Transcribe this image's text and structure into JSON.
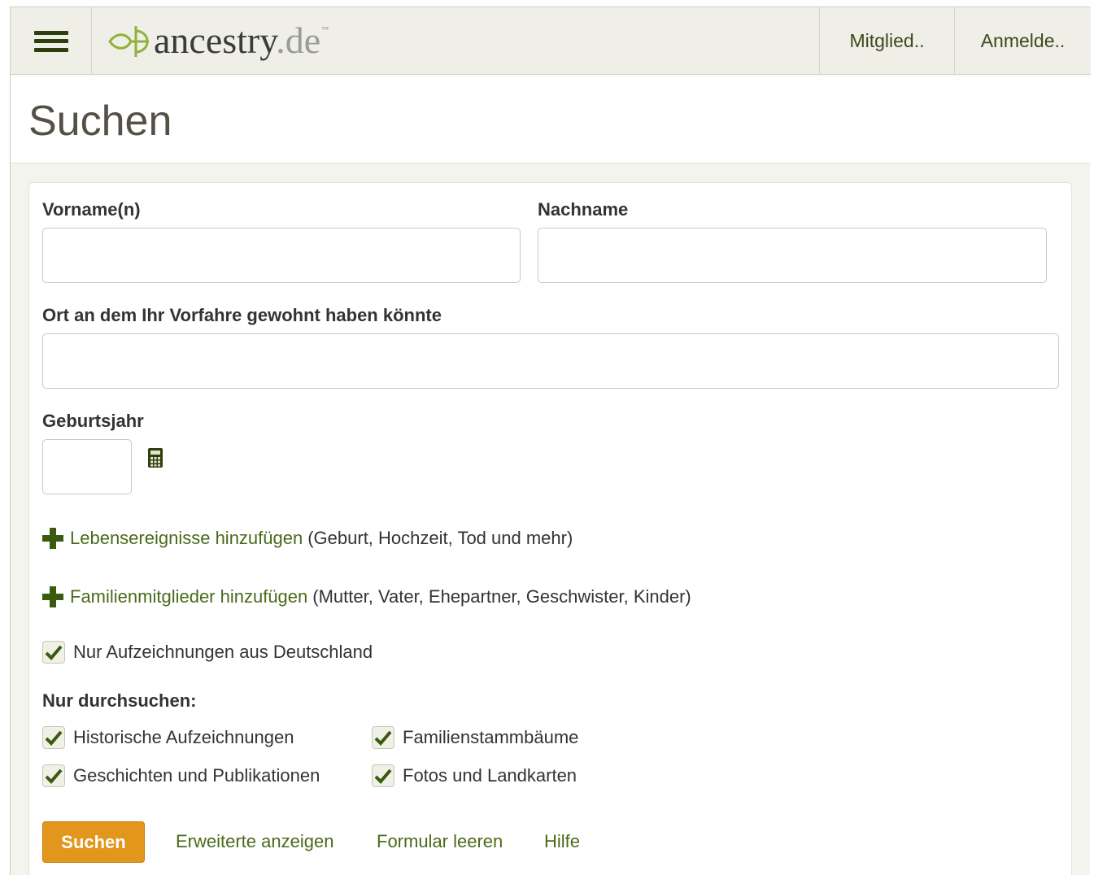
{
  "header": {
    "logo_name": "ancestry",
    "logo_tld": ".de",
    "logo_tm": "™",
    "member_label": "Mitglied..",
    "login_label": "Anmelde.."
  },
  "page": {
    "title": "Suchen"
  },
  "form": {
    "first_name_label": "Vorname(n)",
    "first_name_value": "",
    "last_name_label": "Nachname",
    "last_name_value": "",
    "place_label": "Ort an dem Ihr Vorfahre gewohnt haben könnte",
    "place_value": "",
    "birth_year_label": "Geburtsjahr",
    "birth_year_value": "",
    "life_events_link": "Lebensereignisse hinzufügen",
    "life_events_hint": "(Geburt, Hochzeit, Tod und mehr)",
    "family_link": "Familienmitglieder hinzufügen",
    "family_hint": "(Mutter, Vater, Ehepartner, Geschwister, Kinder)",
    "germany_only_label": "Nur Aufzeichnungen aus Deutschland",
    "germany_only_checked": true,
    "search_only_heading": "Nur durchsuchen:",
    "collections": [
      {
        "label": "Historische Aufzeichnungen",
        "checked": true
      },
      {
        "label": "Familienstammbäume",
        "checked": true
      },
      {
        "label": "Geschichten und Publikationen",
        "checked": true
      },
      {
        "label": "Fotos und Landkarten",
        "checked": true
      }
    ],
    "search_button": "Suchen",
    "show_advanced": "Erweiterte anzeigen",
    "clear_form": "Formular leeren",
    "help": "Hilfe"
  },
  "colors": {
    "accent_green": "#4a6a1a",
    "search_button": "#e3961c",
    "header_bg": "#efefe7"
  }
}
